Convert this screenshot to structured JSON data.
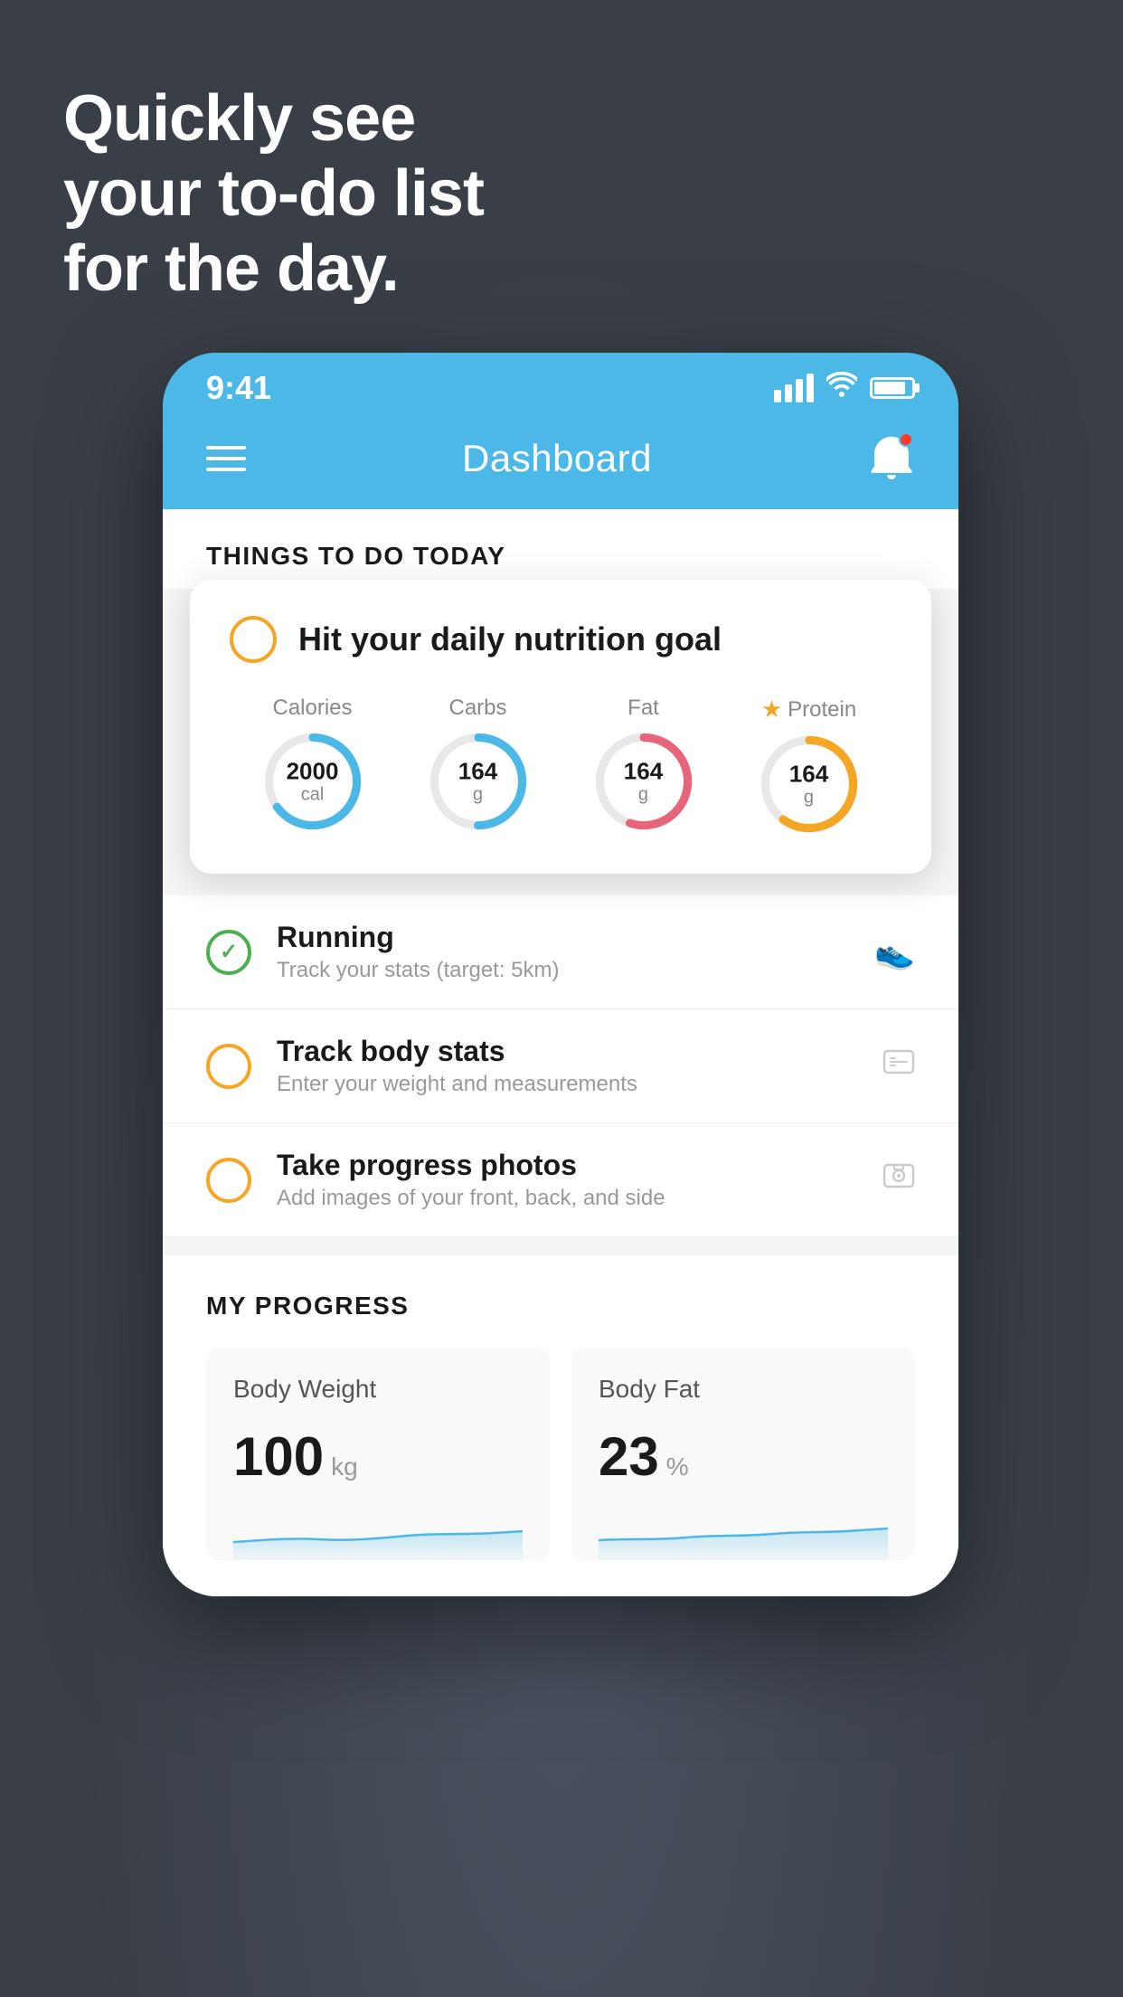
{
  "background": {
    "color": "#3a3f47"
  },
  "headline": {
    "line1": "Quickly see",
    "line2": "your to-do list",
    "line3": "for the day."
  },
  "phone": {
    "statusBar": {
      "time": "9:41"
    },
    "navBar": {
      "title": "Dashboard"
    },
    "sectionHeader": {
      "title": "THINGS TO DO TODAY"
    },
    "floatingCard": {
      "mainItem": {
        "title": "Hit your daily nutrition goal",
        "checked": false
      },
      "nutrition": [
        {
          "label": "Calories",
          "value": "2000",
          "unit": "cal",
          "color": "#4cb8e8",
          "percent": 65,
          "starred": false
        },
        {
          "label": "Carbs",
          "value": "164",
          "unit": "g",
          "color": "#4cb8e8",
          "percent": 50,
          "starred": false
        },
        {
          "label": "Fat",
          "value": "164",
          "unit": "g",
          "color": "#e8647a",
          "percent": 55,
          "starred": false
        },
        {
          "label": "Protein",
          "value": "164",
          "unit": "g",
          "color": "#f5a623",
          "percent": 60,
          "starred": true
        }
      ]
    },
    "todoItems": [
      {
        "title": "Running",
        "subtitle": "Track your stats (target: 5km)",
        "checkType": "green",
        "iconType": "shoe"
      },
      {
        "title": "Track body stats",
        "subtitle": "Enter your weight and measurements",
        "checkType": "yellow",
        "iconType": "scale"
      },
      {
        "title": "Take progress photos",
        "subtitle": "Add images of your front, back, and side",
        "checkType": "yellow",
        "iconType": "photo"
      }
    ],
    "progressSection": {
      "title": "MY PROGRESS",
      "cards": [
        {
          "title": "Body Weight",
          "value": "100",
          "unit": "kg"
        },
        {
          "title": "Body Fat",
          "value": "23",
          "unit": "%"
        }
      ]
    }
  }
}
